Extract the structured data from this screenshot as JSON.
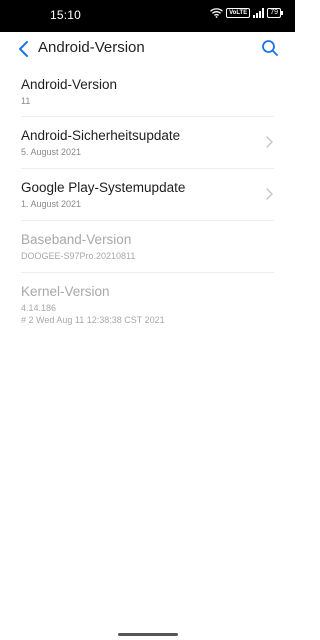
{
  "status_bar": {
    "time": "15:10",
    "volte": "VoLTE",
    "battery": "79"
  },
  "header": {
    "title": "Android-Version"
  },
  "items": [
    {
      "title": "Android-Version",
      "subtitle": "11"
    },
    {
      "title": "Android-Sicherheitsupdate",
      "subtitle": "5. August 2021"
    },
    {
      "title": "Google Play-Systemupdate",
      "subtitle": "1. August 2021"
    },
    {
      "title": "Baseband-Version",
      "subtitle": "DOOGEE-S97Pro.20210811"
    },
    {
      "title": "Kernel-Version",
      "subtitle": "4.14.186",
      "subtitle2": "# 2 Wed Aug 11 12:38:38 CST 2021"
    }
  ],
  "colors": {
    "accent": "#1a73e8",
    "disabled_text": "#a8a8a8"
  }
}
